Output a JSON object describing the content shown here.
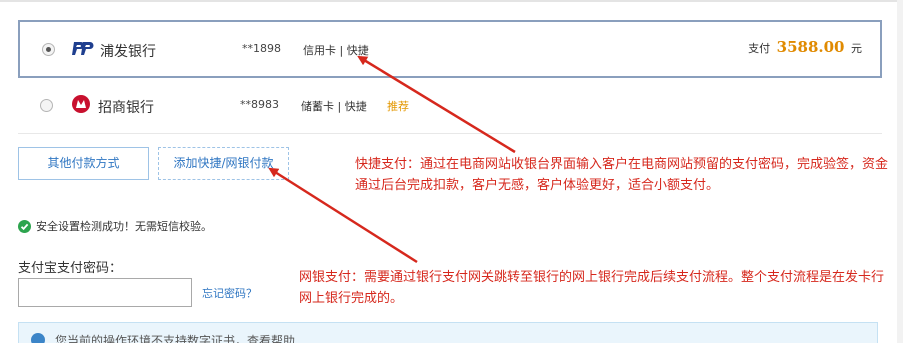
{
  "bank_options": [
    {
      "name": "浦发银行",
      "card_number": "**1898",
      "card_type": "信用卡 | 快捷",
      "selected": true,
      "pay_prefix": "支付",
      "amount": "3588.00",
      "pay_unit": "元"
    },
    {
      "name": "招商银行",
      "card_number": "**8983",
      "card_type": "储蓄卡 | 快捷",
      "recommend": "推荐",
      "selected": false
    }
  ],
  "buttons": {
    "other_payment": "其他付款方式",
    "add_quick_pay": "添加快捷/网银付款"
  },
  "security_check": "安全设置检测成功！无需短信校验。",
  "password": {
    "label": "支付宝支付密码：",
    "value": "",
    "forgot_link": "忘记密码？"
  },
  "info_bar": {
    "text": "您当前的操作环境不支持数字证书，查看帮助"
  },
  "annotations": {
    "quick_pay": "快捷支付：通过在电商网站收银台界面输入客户在电商网站预留的支付密码，完成验签，资金通过后台完成扣款，客户无感，客户体验更好，适合小额支付。",
    "online_banking": "网银支付：需要通过银行支付网关跳转至银行的网上银行完成后续支付流程。整个支付流程是在发卡行网上银行完成的。"
  },
  "colors": {
    "annotation_red": "#d6281d",
    "amount_orange": "#e08a00",
    "link_blue": "#2f76c2",
    "selected_border": "#8a9fbd",
    "success_green": "#2da44e"
  },
  "icons": [
    "radio-selected-icon",
    "radio-unselected-icon",
    "spdb-logo-icon",
    "cmb-logo-icon",
    "check-circle-icon",
    "info-icon"
  ]
}
